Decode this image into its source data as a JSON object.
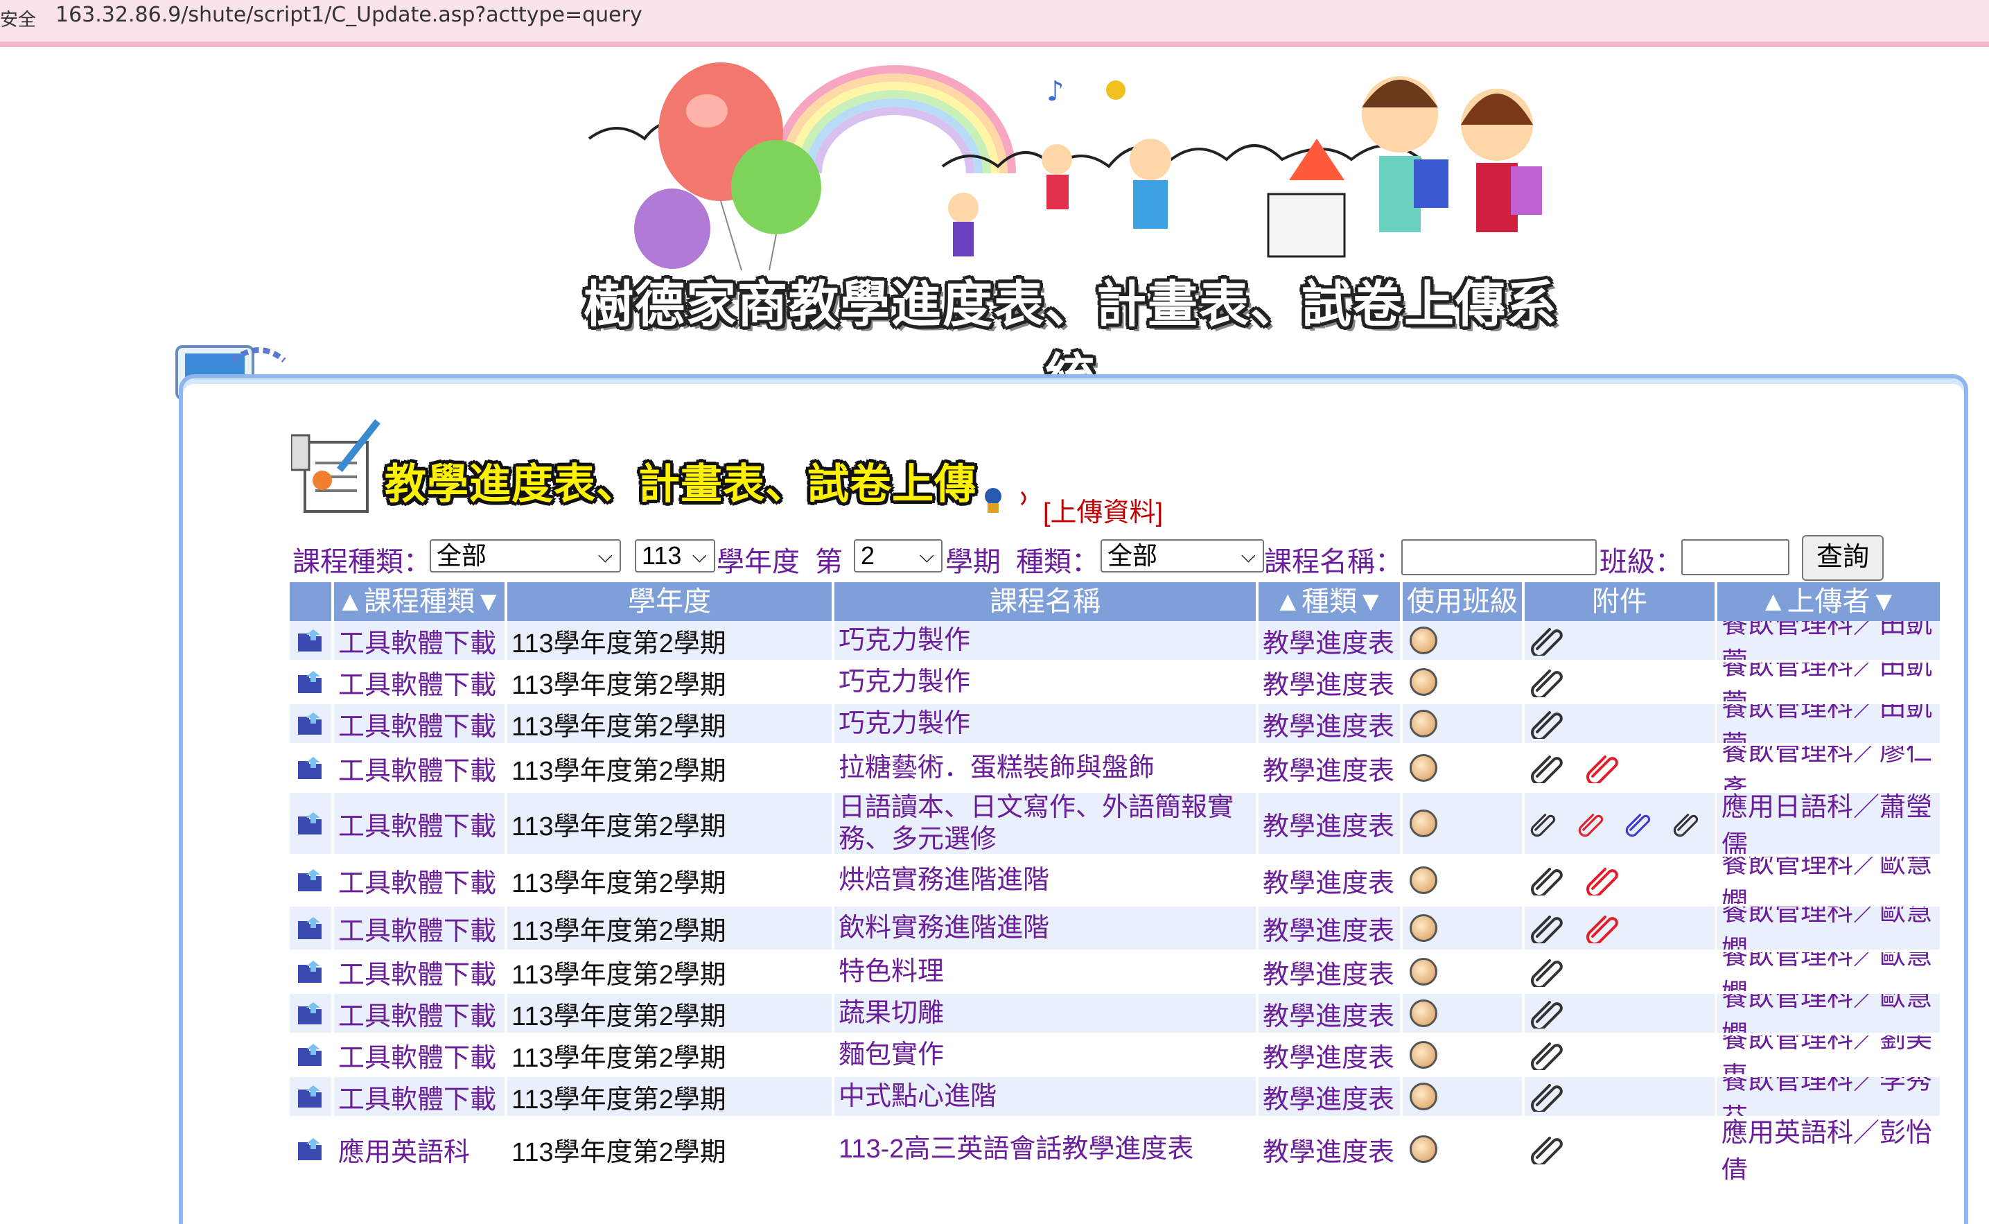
{
  "browser": {
    "secure_label": "安全",
    "url": "163.32.86.9/shute/script1/C_Update.asp?acttype=query"
  },
  "banner": {
    "title": "樹德家商教學進度表、計畫表、試卷上傳系統"
  },
  "section": {
    "title": "教學進度表、計畫表、試卷上傳",
    "upload_link": "[上傳資料]"
  },
  "filters": {
    "course_type_label": "課程種類：",
    "course_type_value": "全部",
    "year_value": "113",
    "year_label": "學年度",
    "nth_label": "第",
    "semester_value": "2",
    "semester_label": "學期",
    "kind_label": "種類：",
    "kind_value": "全部",
    "course_name_label": "課程名稱：",
    "course_name_value": "",
    "class_label": "班級：",
    "class_value": "",
    "query_button": "查詢"
  },
  "table": {
    "headers": {
      "course_type": "▲課程種類▼",
      "year": "學年度",
      "course_name": "課程名稱",
      "kind": "▲種類▼",
      "class": "使用班級",
      "attachment": "附件",
      "uploader": "▲上傳者▼"
    },
    "rows": [
      {
        "type": "工具軟體下載",
        "year": "113學年度第2學期",
        "course": "巧克力製作",
        "kind": "教學進度表",
        "uploader": "餐飲管理科／田凱萱",
        "clips": [
          "black"
        ]
      },
      {
        "type": "工具軟體下載",
        "year": "113學年度第2學期",
        "course": "巧克力製作",
        "kind": "教學進度表",
        "uploader": "餐飲管理科／田凱萱",
        "clips": [
          "black"
        ]
      },
      {
        "type": "工具軟體下載",
        "year": "113學年度第2學期",
        "course": "巧克力製作",
        "kind": "教學進度表",
        "uploader": "餐飲管理科／田凱萱",
        "clips": [
          "black"
        ]
      },
      {
        "type": "工具軟體下載",
        "year": "113學年度第2學期",
        "course": "拉糖藝術．蛋糕裝飾與盤飾",
        "kind": "教學進度表",
        "uploader": "餐飲管理科／廖仁彥",
        "clips": [
          "black",
          "red"
        ]
      },
      {
        "type": "工具軟體下載",
        "year": "113學年度第2學期",
        "course": "日語讀本、日文寫作、外語簡報實務、多元選修",
        "kind": "教學進度表",
        "uploader": "應用日語科／蕭瑩儒",
        "clips": [
          "black",
          "red",
          "blue",
          "black"
        ]
      },
      {
        "type": "工具軟體下載",
        "year": "113學年度第2學期",
        "course": "烘焙實務進階進階",
        "kind": "教學進度表",
        "uploader": "餐飲管理科／歐慧嫻",
        "clips": [
          "black",
          "red"
        ]
      },
      {
        "type": "工具軟體下載",
        "year": "113學年度第2學期",
        "course": "飲料實務進階進階",
        "kind": "教學進度表",
        "uploader": "餐飲管理科／歐慧嫻",
        "clips": [
          "black",
          "red"
        ]
      },
      {
        "type": "工具軟體下載",
        "year": "113學年度第2學期",
        "course": "特色料理",
        "kind": "教學進度表",
        "uploader": "餐飲管理科／歐慧嫻",
        "clips": [
          "black"
        ]
      },
      {
        "type": "工具軟體下載",
        "year": "113學年度第2學期",
        "course": "蔬果切雕",
        "kind": "教學進度表",
        "uploader": "餐飲管理科／歐慧嫻",
        "clips": [
          "black"
        ]
      },
      {
        "type": "工具軟體下載",
        "year": "113學年度第2學期",
        "course": "麵包實作",
        "kind": "教學進度表",
        "uploader": "餐飲管理科／劉美惠",
        "clips": [
          "black"
        ]
      },
      {
        "type": "工具軟體下載",
        "year": "113學年度第2學期",
        "course": "中式點心進階",
        "kind": "教學進度表",
        "uploader": "餐飲管理科／李秀芬",
        "clips": [
          "black"
        ]
      },
      {
        "type": "應用英語科",
        "year": "113學年度第2學期",
        "course": "113-2高三英語會話教學進度表",
        "kind": "教學進度表",
        "uploader": "應用英語科／彭怡倩",
        "clips": [
          "black"
        ]
      }
    ]
  },
  "colors": {
    "clip_black": "#333333",
    "clip_red": "#e0202a",
    "clip_blue": "#3a3ad0"
  }
}
